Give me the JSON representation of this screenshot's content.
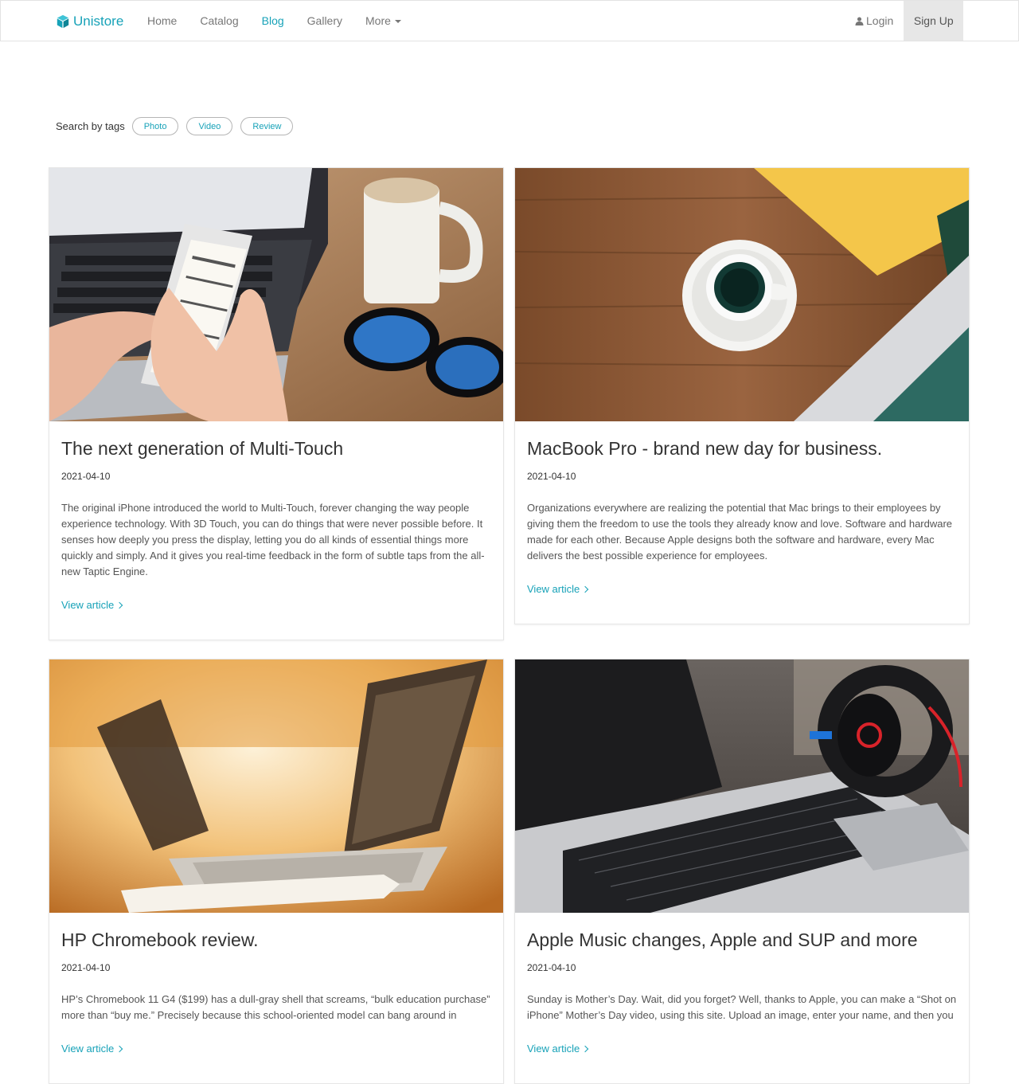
{
  "brand": {
    "name": "Unistore",
    "icon": "cube-icon",
    "color": "#17a2b8"
  },
  "nav": {
    "items": [
      {
        "label": "Home"
      },
      {
        "label": "Catalog"
      },
      {
        "label": "Blog"
      },
      {
        "label": "Gallery"
      },
      {
        "label": "More"
      }
    ],
    "active": "Blog",
    "login": "Login",
    "signup": "Sign Up"
  },
  "tags": {
    "label": "Search by tags",
    "items": [
      "Photo",
      "Video",
      "Review"
    ]
  },
  "posts": [
    {
      "title": "The next generation of Multi-Touch",
      "date": "2021-04-10",
      "excerpt": "The original iPhone introduced the world to Multi-Touch, forever changing the way people experience technology. With 3D Touch, you can do things that were never possible before. It senses how deeply you press the display, letting you do all kinds of essential things more quickly and simply. And it gives you real-time feedback in the form of subtle taps from the all-new Taptic Engine.",
      "link": "View article",
      "image": "phone-laptop-coffee-photo"
    },
    {
      "title": "MacBook Pro - brand new day for business.",
      "date": "2021-04-10",
      "excerpt": "Organizations everywhere are realizing the potential that Mac brings to their employees by giving them the freedom to use the tools they already know and love. Software and hardware made for each other. Because Apple designs both the software and hardware, every Mac delivers the best possible experience for employees.",
      "link": "View article",
      "image": "coffee-cup-macbook-photo"
    },
    {
      "title": "HP Chromebook review.",
      "date": "2021-04-10",
      "excerpt": "HP’s Chromebook 11 G4 ($199) has a dull-gray shell that screams, “bulk education purchase” more than “buy me.” Precisely because this school-oriented model can bang around in",
      "link": "View article",
      "image": "laptop-warm-light-photo"
    },
    {
      "title": "Apple Music changes, Apple and SUP and more",
      "date": "2021-04-10",
      "excerpt": "Sunday is Mother’s Day. Wait, did you forget? Well, thanks to Apple, you can make a “Shot on iPhone” Mother’s Day video, using this site. Upload an image, enter your name, and then you",
      "link": "View article",
      "image": "laptop-headphones-photo"
    }
  ]
}
